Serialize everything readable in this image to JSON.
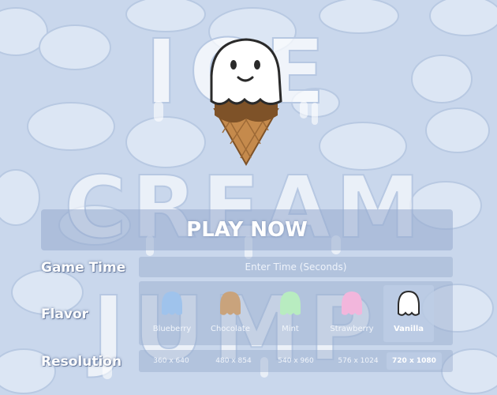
{
  "game": {
    "title_words": [
      "ICE",
      "CREAM",
      "JUMP"
    ],
    "play_label": "PLAY NOW"
  },
  "menu": {
    "game_time_label": "Game Time",
    "game_time_placeholder": "Enter Time (Seconds)",
    "flavor_label": "Flavor",
    "resolution_label": "Resolution",
    "flavors": [
      {
        "label": "Blueberry",
        "color": "#9fc3ec",
        "selected": false
      },
      {
        "label": "Chocolate",
        "color": "#c9a37c",
        "selected": false
      },
      {
        "label": "Mint",
        "color": "#b8ecc0",
        "selected": false
      },
      {
        "label": "Strawberry",
        "color": "#f2b6dc",
        "selected": false
      },
      {
        "label": "Vanilla",
        "color": "#ffffff",
        "selected": true
      }
    ],
    "resolutions": [
      {
        "label": "360 x 640",
        "selected": false
      },
      {
        "label": "480 x 854",
        "selected": false
      },
      {
        "label": "540 x 960",
        "selected": false
      },
      {
        "label": "576 x 1024",
        "selected": false
      },
      {
        "label": "720 x 1080",
        "selected": true
      }
    ]
  },
  "colors": {
    "background": "#c9d7ec",
    "cloud": "#dde7f5",
    "cone": "#c58a4c",
    "cone_shadow": "#7e5228"
  }
}
